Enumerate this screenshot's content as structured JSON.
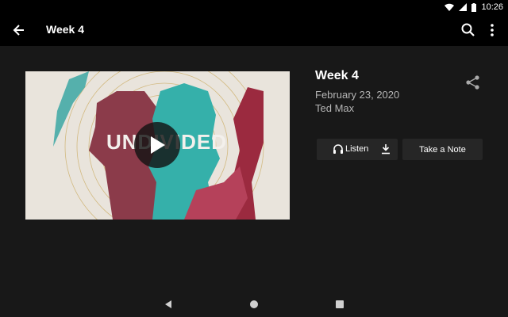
{
  "status": {
    "time": "10:26"
  },
  "app_bar": {
    "title": "Week 4"
  },
  "video": {
    "overlay_word": "UNDIVIDED"
  },
  "sermon": {
    "title": "Week 4",
    "date": "February 23, 2020",
    "speaker": "Ted Max"
  },
  "actions": {
    "listen_label": "Listen",
    "note_label": "Take a Note"
  },
  "colors": {
    "background": "#181818",
    "bar": "#000000",
    "button": "#262626"
  }
}
